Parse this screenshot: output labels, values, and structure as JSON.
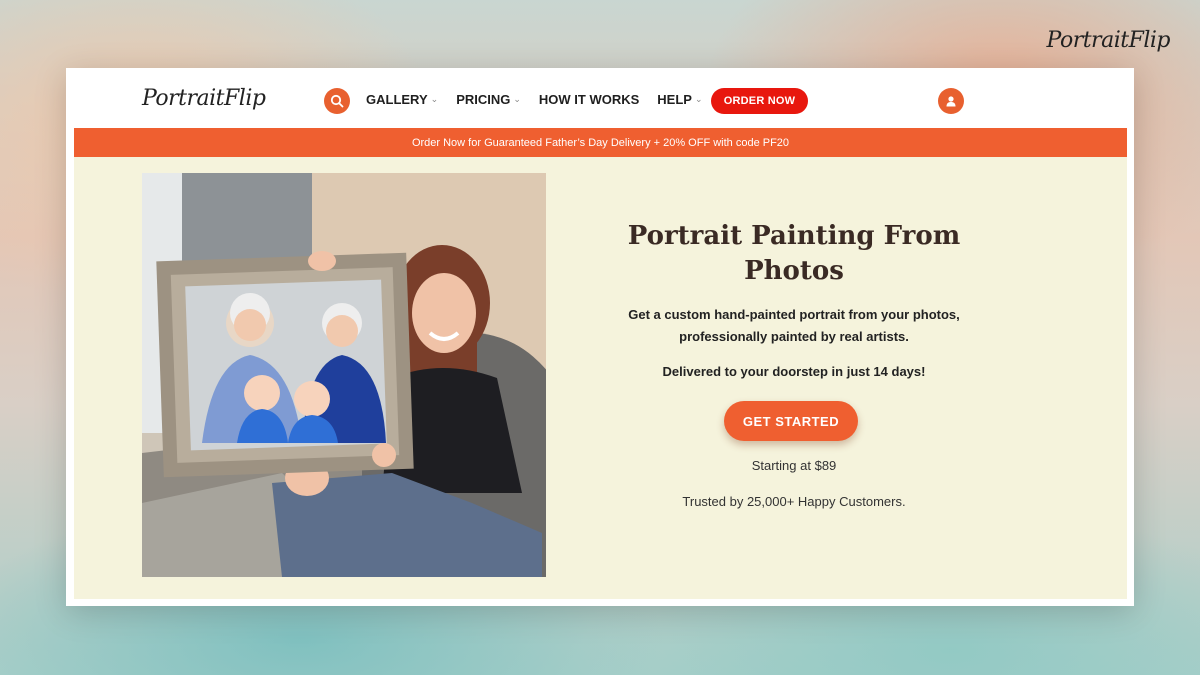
{
  "brand": {
    "name": "PortraitFlip",
    "name_part1": "Portrait",
    "name_part2": "Flip"
  },
  "nav": {
    "items": [
      {
        "label": "GALLERY",
        "has_dropdown": true
      },
      {
        "label": "PRICING",
        "has_dropdown": true
      },
      {
        "label": "HOW IT WORKS",
        "has_dropdown": false
      },
      {
        "label": "HELP",
        "has_dropdown": true
      }
    ],
    "order_button": "ORDER NOW",
    "search_icon": "search-icon",
    "account_icon": "user-icon"
  },
  "promo": {
    "text": "Order Now for Guaranteed Father’s Day Delivery + 20% OFF with code PF20"
  },
  "hero": {
    "title": "Portrait Painting From Photos",
    "subtitle_line1": "Get a custom hand-painted portrait from your photos,",
    "subtitle_line2": "professionally painted by real artists.",
    "delivery": "Delivered to your doorstep in just 14 days!",
    "cta": "GET STARTED",
    "starting_price": "Starting at $89",
    "trusted": "Trusted by 25,000+ Happy Customers."
  },
  "colors": {
    "accent": "#ef5f30",
    "order_red": "#e8170e",
    "hero_bg": "#f5f3dc"
  }
}
